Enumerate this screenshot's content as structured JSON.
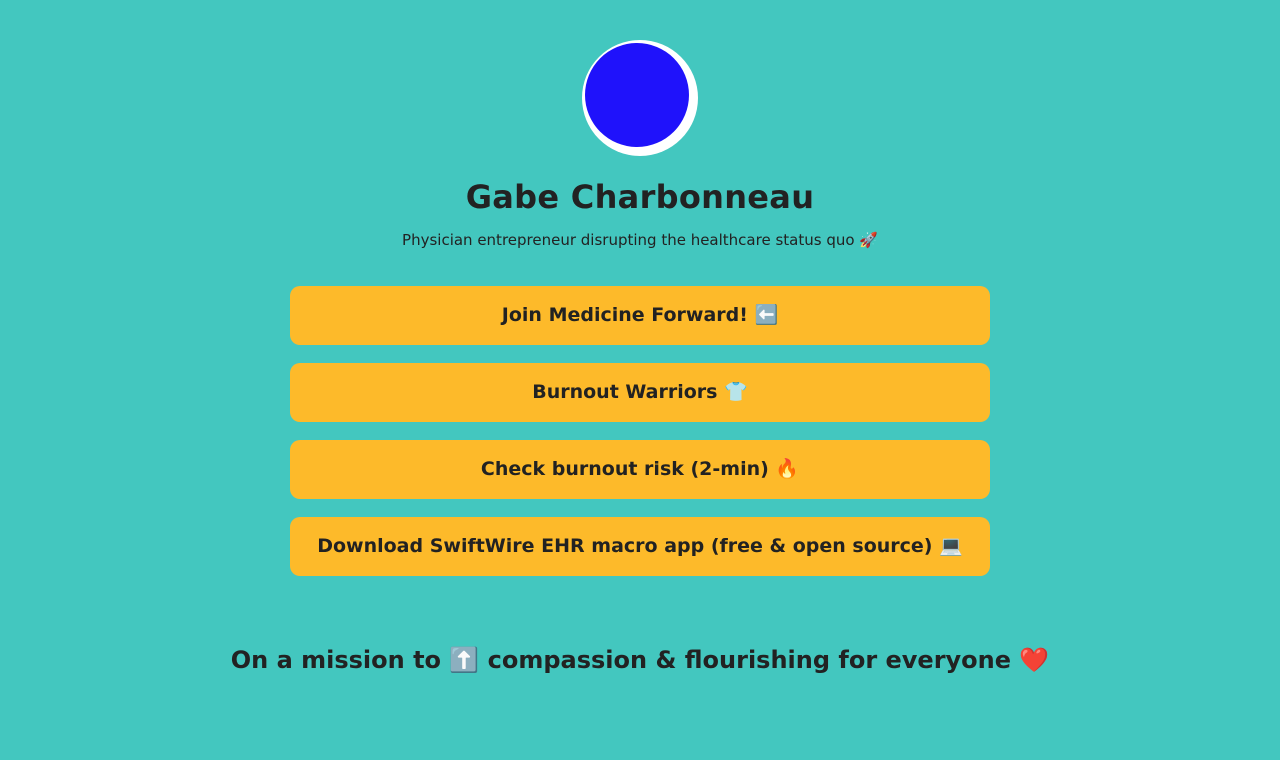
{
  "profile": {
    "name": "Gabe Charbonneau",
    "bio": "Physician entrepreneur disrupting the healthcare status quo 🚀",
    "avatar_color": "#1f12fb"
  },
  "links": [
    {
      "label": "Join Medicine Forward! ⬅️"
    },
    {
      "label": "Burnout Warriors 👕"
    },
    {
      "label": "Check burnout risk (2-min) 🔥"
    },
    {
      "label": "Download SwiftWire EHR macro app (free & open source) 💻"
    }
  ],
  "footer": {
    "mission": "On a mission to ⬆️ compassion & flourishing for everyone ❤️"
  },
  "colors": {
    "background": "#43c7bf",
    "button": "#fdba2a",
    "text": "#222222"
  }
}
